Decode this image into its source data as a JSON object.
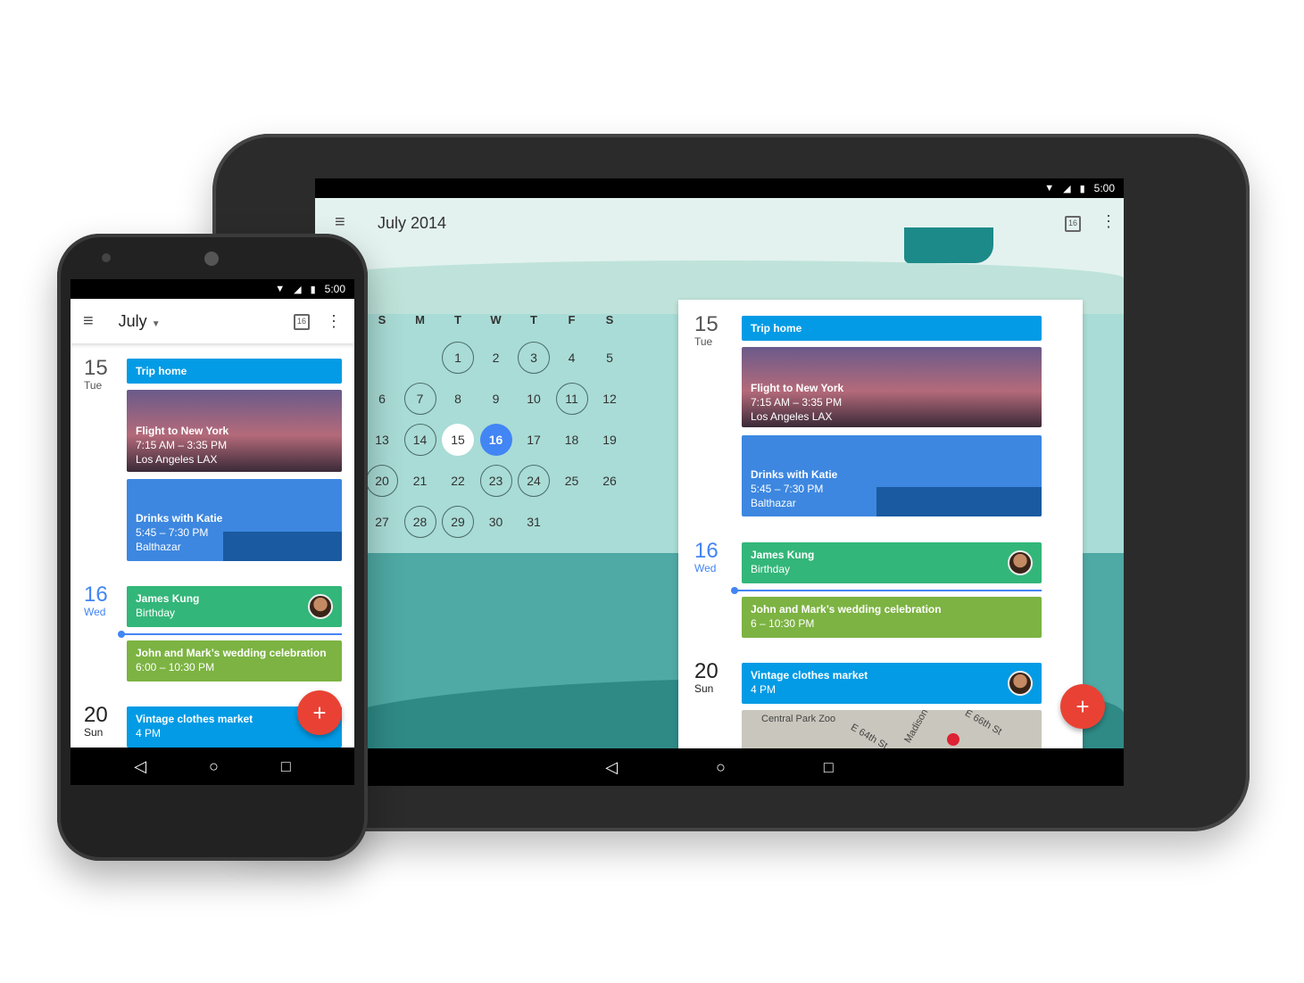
{
  "status": {
    "time": "5:00"
  },
  "tablet": {
    "title": "July 2014",
    "weekdays": [
      "S",
      "M",
      "T",
      "W",
      "T",
      "F",
      "S"
    ],
    "first_weekday": 2,
    "days_in_month": 31,
    "circled_days": [
      1,
      3,
      7,
      11,
      14,
      20,
      23,
      24,
      28,
      29
    ],
    "today": 15,
    "selected": 16,
    "today_icon_label": "16",
    "agenda": {
      "d15": {
        "num": "15",
        "label": "Tue"
      },
      "d16": {
        "num": "16",
        "label": "Wed"
      },
      "d20": {
        "num": "20",
        "label": "Sun"
      },
      "trip": "Trip home",
      "flight": {
        "title": "Flight to New York",
        "time": "7:15 AM – 3:35 PM",
        "place": "Los Angeles LAX"
      },
      "drinks": {
        "title": "Drinks with Katie",
        "time": "5:45 – 7:30 PM",
        "place": "Balthazar"
      },
      "birthday": {
        "title": "James Kung",
        "sub": "Birthday"
      },
      "wedding": {
        "title": "John and Mark’s wedding celebration",
        "time": "6 – 10:30 PM"
      },
      "market": {
        "title": "Vintage clothes market",
        "time": "4 PM"
      },
      "map": {
        "labels": [
          "Central Park Zoo",
          "E 64th St",
          "Madison",
          "E 66th St"
        ]
      }
    }
  },
  "phone": {
    "title": "July",
    "today_icon_label": "16",
    "agenda": {
      "d15": {
        "num": "15",
        "label": "Tue"
      },
      "d16": {
        "num": "16",
        "label": "Wed"
      },
      "d20": {
        "num": "20",
        "label": "Sun"
      },
      "trip": "Trip home",
      "flight": {
        "title": "Flight to New York",
        "time": "7:15 AM – 3:35 PM",
        "place": "Los Angeles LAX"
      },
      "drinks": {
        "title": "Drinks with Katie",
        "time": "5:45 – 7:30 PM",
        "place": "Balthazar"
      },
      "birthday": {
        "title": "James Kung",
        "sub": "Birthday"
      },
      "wedding": {
        "title": "John and Mark’s wedding celebration",
        "time": "6:00 – 10:30 PM"
      },
      "market": {
        "title": "Vintage clothes market",
        "time": "4 PM"
      }
    }
  },
  "fab_label": "+",
  "colors": {
    "blue_event": "#039be5",
    "green_event": "#33b679",
    "olive_event": "#7cb342",
    "accent": "#4285f4",
    "fab": "#e94235"
  }
}
